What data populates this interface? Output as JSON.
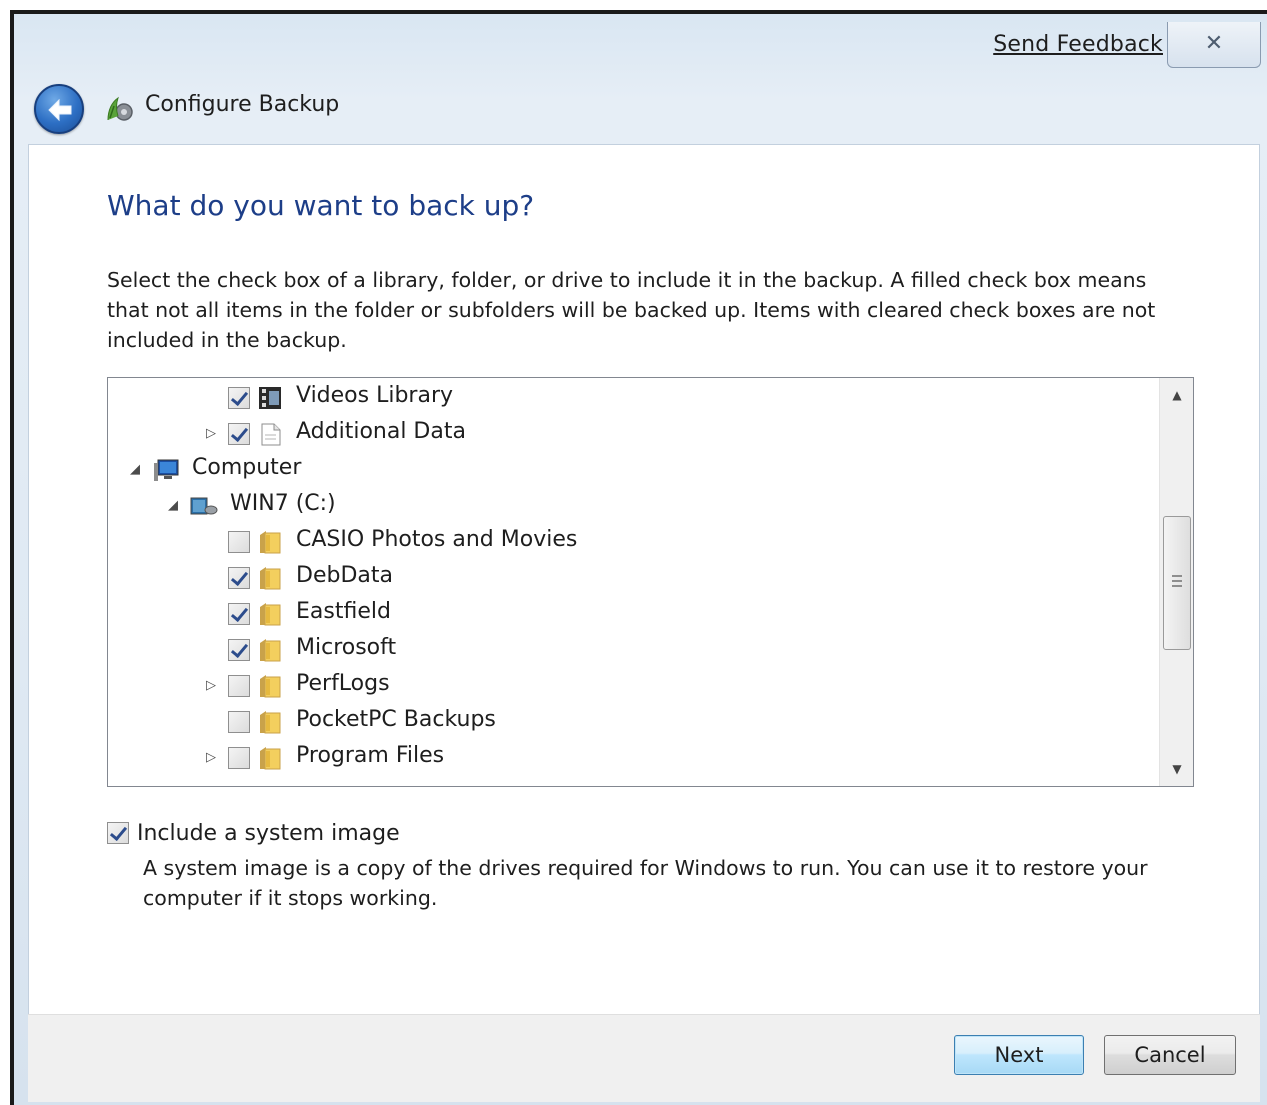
{
  "window": {
    "title": "Configure Backup",
    "feedback_link": "Send Feedback",
    "close_glyph": "✕"
  },
  "page": {
    "heading": "What do you want to back up?",
    "description": "Select the check box of a library, folder, or drive to include it in the backup. A filled check box means that not all items in the folder or subfolders will be backed up. Items with cleared check boxes are not included in the backup."
  },
  "tree": {
    "items": [
      {
        "label": "Videos Library",
        "checked": true,
        "icon": "videos-library-icon",
        "expander": ""
      },
      {
        "label": "Additional Data",
        "checked": true,
        "icon": "document-icon",
        "expander": "collapsed"
      },
      {
        "label": "Computer",
        "checked": null,
        "icon": "computer-icon",
        "expander": "expanded"
      },
      {
        "label": "WIN7 (C:)",
        "checked": null,
        "icon": "drive-icon",
        "expander": "expanded"
      },
      {
        "label": "CASIO Photos and Movies",
        "checked": false,
        "icon": "folder-icon",
        "expander": ""
      },
      {
        "label": "DebData",
        "checked": true,
        "icon": "folder-icon",
        "expander": ""
      },
      {
        "label": "Eastfield",
        "checked": true,
        "icon": "folder-icon",
        "expander": ""
      },
      {
        "label": "Microsoft",
        "checked": true,
        "icon": "folder-icon",
        "expander": ""
      },
      {
        "label": "PerfLogs",
        "checked": false,
        "icon": "folder-icon",
        "expander": "collapsed"
      },
      {
        "label": "PocketPC Backups",
        "checked": false,
        "icon": "folder-icon",
        "expander": ""
      },
      {
        "label": "Program Files",
        "checked": false,
        "icon": "folder-icon",
        "expander": "collapsed"
      }
    ]
  },
  "system_image": {
    "label": "Include a system image",
    "checked": true,
    "description": "A system image is a copy of the drives required for Windows to run. You can use it to restore your computer if it stops working."
  },
  "buttons": {
    "next": "Next",
    "cancel": "Cancel"
  }
}
